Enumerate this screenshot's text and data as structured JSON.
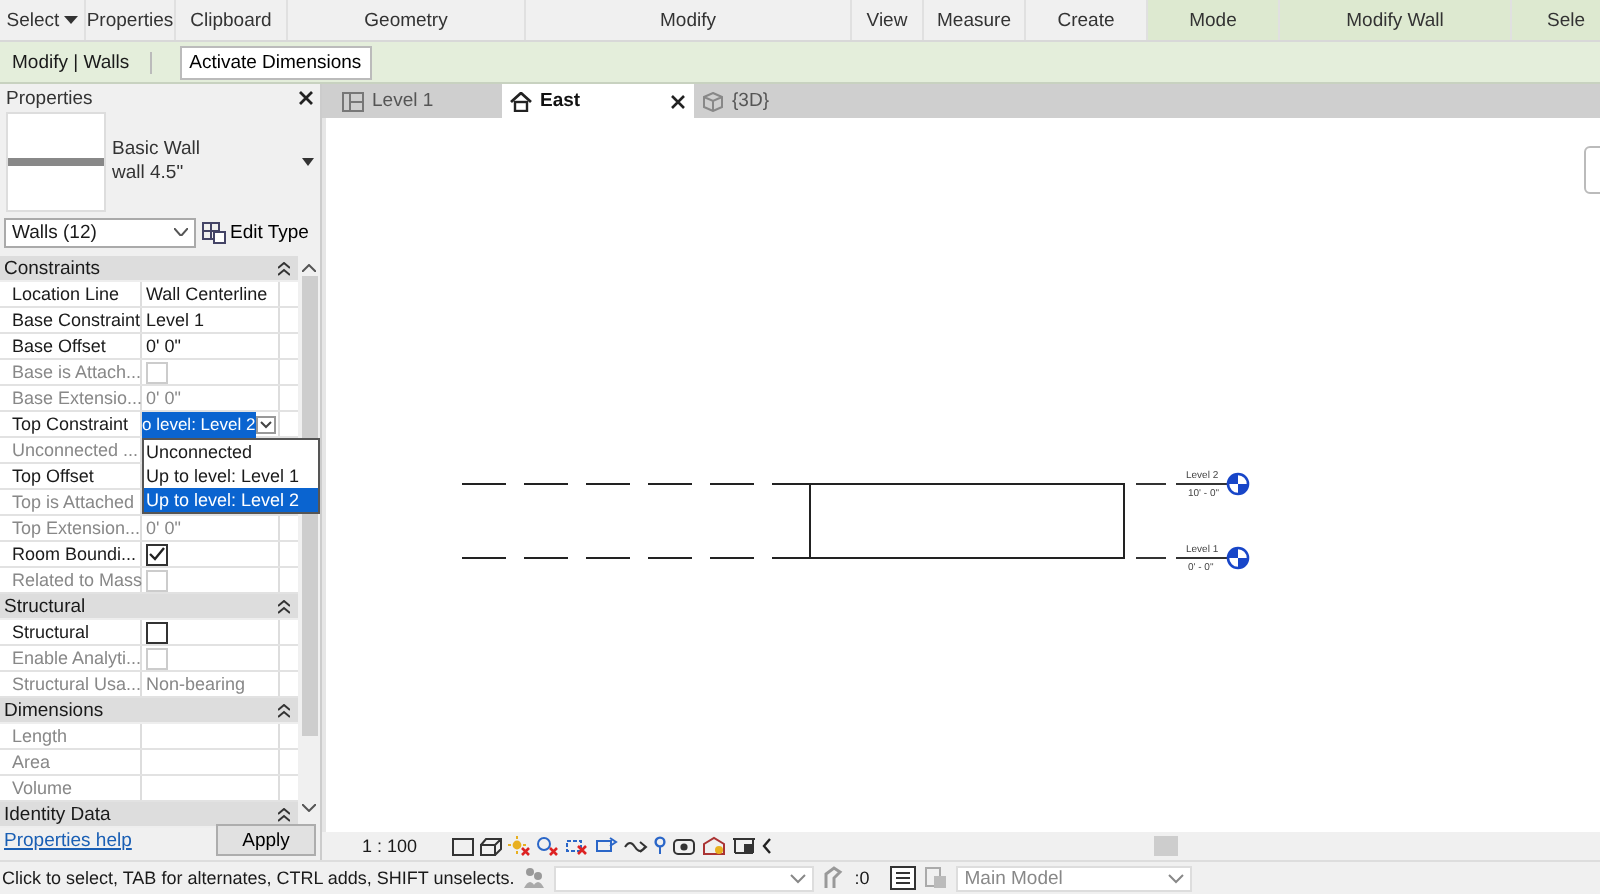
{
  "ribbon": {
    "panels": [
      {
        "label": "Select",
        "caret": true,
        "contextual": false
      },
      {
        "label": "Properties",
        "caret": false,
        "contextual": false
      },
      {
        "label": "Clipboard",
        "caret": false,
        "contextual": false
      },
      {
        "label": "Geometry",
        "caret": false,
        "contextual": false
      },
      {
        "label": "Modify",
        "caret": false,
        "contextual": false
      },
      {
        "label": "View",
        "caret": false,
        "contextual": false
      },
      {
        "label": "Measure",
        "caret": false,
        "contextual": false
      },
      {
        "label": "Create",
        "caret": false,
        "contextual": false
      },
      {
        "label": "Mode",
        "caret": false,
        "contextual": true
      },
      {
        "label": "Modify Wall",
        "caret": false,
        "contextual": true
      },
      {
        "label": "Sele",
        "caret": false,
        "contextual": true
      }
    ]
  },
  "options_bar": {
    "context": "Modify | Walls",
    "button": "Activate Dimensions"
  },
  "properties": {
    "title": "Properties",
    "type_family": "Basic Wall",
    "type_name": "wall 4.5\"",
    "filter": "Walls (12)",
    "edit_type": "Edit Type",
    "sections": [
      {
        "title": "Constraints",
        "rows": [
          {
            "label": "Location Line",
            "kind": "text",
            "value": "Wall Centerline",
            "enabled": true
          },
          {
            "label": "Base Constraint",
            "kind": "text",
            "value": "Level 1",
            "enabled": true
          },
          {
            "label": "Base Offset",
            "kind": "text",
            "value": "0'  0\"",
            "enabled": true
          },
          {
            "label": "Base is Attach...",
            "kind": "checkbox",
            "checked": false,
            "enabled": false
          },
          {
            "label": "Base Extensio...",
            "kind": "text",
            "value": "0'  0\"",
            "enabled": false
          },
          {
            "label": "Top Constraint",
            "kind": "dropdown",
            "value": "o level: Level 2",
            "enabled": true
          },
          {
            "label": "Unconnected ...",
            "kind": "text",
            "enabled": false
          },
          {
            "label": "Top Offset",
            "kind": "text",
            "enabled": true
          },
          {
            "label": "Top is Attached",
            "kind": "text",
            "enabled": false
          },
          {
            "label": "Top Extension...",
            "kind": "text",
            "value": "0'  0\"",
            "enabled": false
          },
          {
            "label": "Room Boundi...",
            "kind": "checkbox",
            "checked": true,
            "enabled": true
          },
          {
            "label": "Related to Mass",
            "kind": "checkbox",
            "checked": false,
            "enabled": false
          }
        ]
      },
      {
        "title": "Structural",
        "rows": [
          {
            "label": "Structural",
            "kind": "checkbox",
            "checked": false,
            "enabled": true
          },
          {
            "label": "Enable Analyti...",
            "kind": "checkbox",
            "checked": false,
            "enabled": false
          },
          {
            "label": "Structural Usa...",
            "kind": "text",
            "value": "Non-bearing",
            "enabled": false
          }
        ]
      },
      {
        "title": "Dimensions",
        "rows": [
          {
            "label": "Length",
            "kind": "text",
            "enabled": false
          },
          {
            "label": "Area",
            "kind": "text",
            "enabled": false
          },
          {
            "label": "Volume",
            "kind": "text",
            "enabled": false
          }
        ]
      },
      {
        "title": "Identity Data"
      }
    ],
    "dropdown_options": [
      {
        "label": "Unconnected",
        "selected": false
      },
      {
        "label": "Up to level: Level 1",
        "selected": false
      },
      {
        "label": "Up to level: Level 2",
        "selected": true
      }
    ],
    "help_link": "Properties help",
    "apply": "Apply"
  },
  "view_tabs": [
    {
      "label": "Level 1",
      "kind": "plan",
      "selected": false
    },
    {
      "label": "East",
      "kind": "elevation",
      "selected": true
    },
    {
      "label": "{3D}",
      "kind": "model",
      "selected": false
    }
  ],
  "drawing": {
    "levels": [
      {
        "name": "Level 2",
        "elevation": "10' - 0\""
      },
      {
        "name": "Level 1",
        "elevation": "0' - 0\""
      }
    ]
  },
  "view_bar": {
    "scale": "1 : 100"
  },
  "status_bar": {
    "message": "Click to select, TAB for alternates, CTRL adds, SHIFT unselects.",
    "count": ":0",
    "model": "Main Model"
  }
}
